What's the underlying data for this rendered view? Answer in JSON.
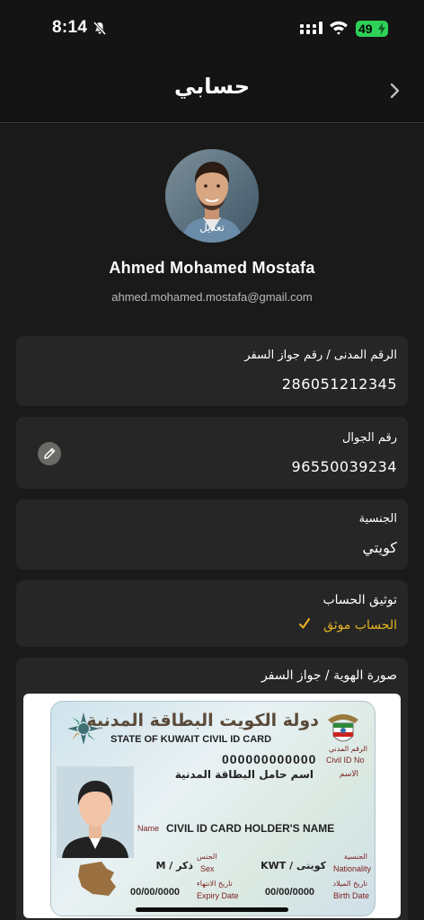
{
  "status_bar": {
    "time": "8:14",
    "battery": "49"
  },
  "header": {
    "title": "حسابي"
  },
  "profile": {
    "edit_label": "تعديل",
    "name": "Ahmed Mohamed Mostafa",
    "email": "ahmed.mohamed.mostafa@gmail.com"
  },
  "fields": {
    "civil_id": {
      "label": "الرقم المدنى / رقم جواز السفر",
      "value": "286051212345"
    },
    "phone": {
      "label": "رقم الجوال",
      "value": "96550039234"
    },
    "nationality": {
      "label": "الجنسية",
      "value": "كويتي"
    },
    "verification": {
      "label": "توثيق الحساب",
      "status": "الحساب موثق"
    },
    "id_image": {
      "label": "صورة الهوية / جواز السفر"
    }
  },
  "id_card": {
    "title_ar": "دولة الكويت البطاقة المدنية",
    "title_en": "STATE OF KUWAIT CIVIL ID CARD",
    "civil_no": "000000000000",
    "civil_no_label_en": "Civil ID No",
    "civil_no_label_ar": "الرقم المدني",
    "holder_ar": "اسم حامل البطاقة المدنية",
    "name_label_ar": "الاسم",
    "name_label_en": "Name",
    "holder_en": "CIVIL ID CARD HOLDER'S NAME",
    "sex_value": "ذكر / M",
    "sex_label_ar": "الجنس",
    "sex_label_en": "Sex",
    "nationality_value": "كويتى / KWT",
    "nationality_label_ar": "الجنسية",
    "nationality_label_en": "Nationality",
    "expiry_value": "00/00/0000",
    "expiry_label_ar": "تاريخ الانتهاء",
    "expiry_label_en": "Expiry Date",
    "birth_value": "00/00/0000",
    "birth_label_ar": "تاريخ الميلاد",
    "birth_label_en": "Birth Date"
  },
  "colors": {
    "background": "#1a1a1a",
    "card": "#262626",
    "accent_verified": "#e6b422",
    "battery": "#2fd158"
  },
  "icons": [
    "bell-off-icon",
    "signal-icon",
    "wifi-icon",
    "chevron-right-icon",
    "pencil-icon",
    "check-icon"
  ]
}
